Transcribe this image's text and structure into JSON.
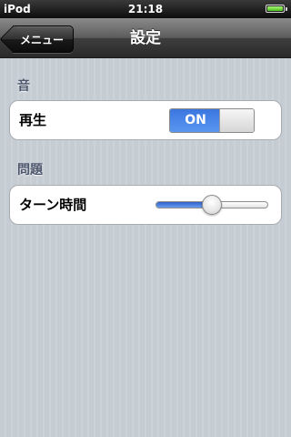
{
  "status_bar": {
    "carrier": "iPod",
    "time": "21:18",
    "battery_level": 1.0,
    "battery_icon": "battery-icon",
    "battery_color": "#4ec41b"
  },
  "nav": {
    "back_label": "メニュー",
    "title": "設定"
  },
  "sections": [
    {
      "header": "音",
      "row": {
        "label": "再生",
        "control": "switch",
        "switch_text": "ON",
        "value": true
      }
    },
    {
      "header": "問題",
      "row": {
        "label": "ターン時間",
        "control": "slider",
        "value": 0.5
      }
    }
  ],
  "colors": {
    "accent": "#3b76e0",
    "background": "#c5ccd4",
    "section_header": "#4c566c"
  }
}
